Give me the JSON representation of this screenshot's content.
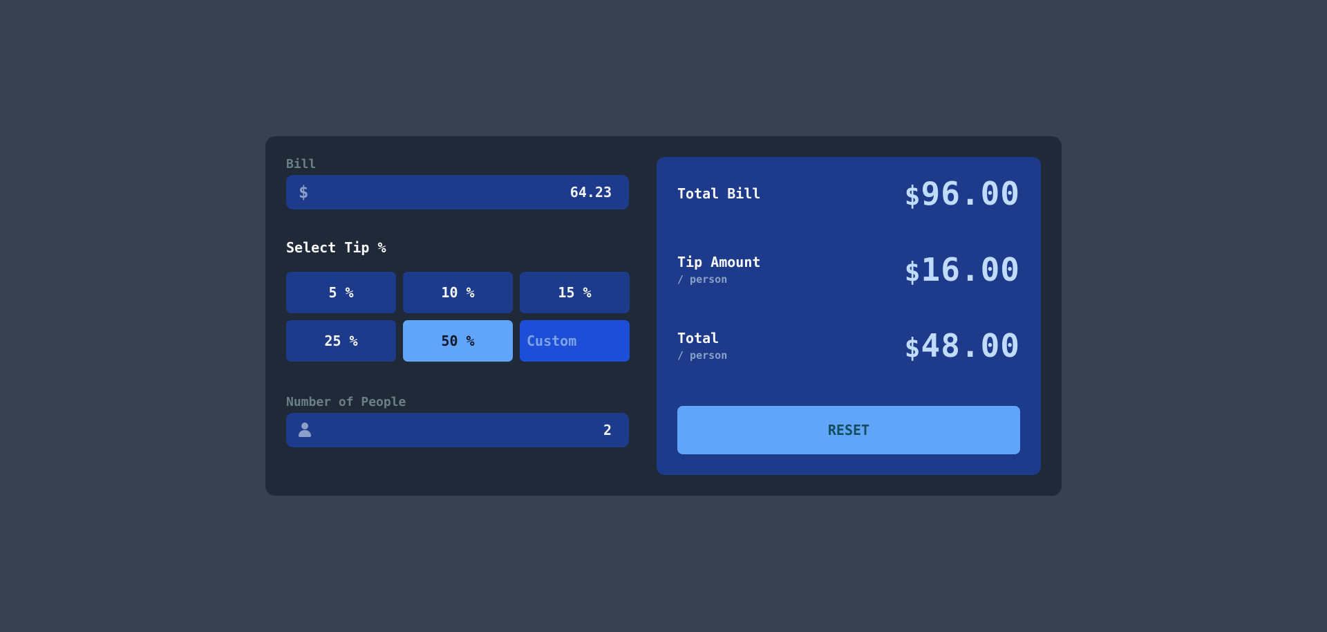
{
  "bill": {
    "label": "Bill",
    "currency_symbol": "$",
    "value": "64.23"
  },
  "tip": {
    "title": "Select Tip %",
    "options": [
      {
        "label": "5 %"
      },
      {
        "label": "10 %"
      },
      {
        "label": "15 %"
      },
      {
        "label": "25 %"
      },
      {
        "label": "50 %",
        "selected": true
      }
    ],
    "custom_placeholder": "Custom"
  },
  "people": {
    "label": "Number of People",
    "icon": "person-icon",
    "value": "2"
  },
  "results": {
    "total_bill": {
      "label": "Total Bill",
      "currency": "$",
      "value": "96.00"
    },
    "tip_amount": {
      "label": "Tip Amount",
      "sub": "/ person",
      "currency": "$",
      "value": "16.00"
    },
    "total": {
      "label": "Total",
      "sub": "/ person",
      "currency": "$",
      "value": "48.00"
    },
    "reset_label": "RESET"
  },
  "colors": {
    "page_bg": "#374151",
    "card_bg": "#1f2937",
    "panel_bg": "#1e3a8a",
    "accent": "#60a5fa",
    "custom_bg": "#1d4ed8"
  }
}
